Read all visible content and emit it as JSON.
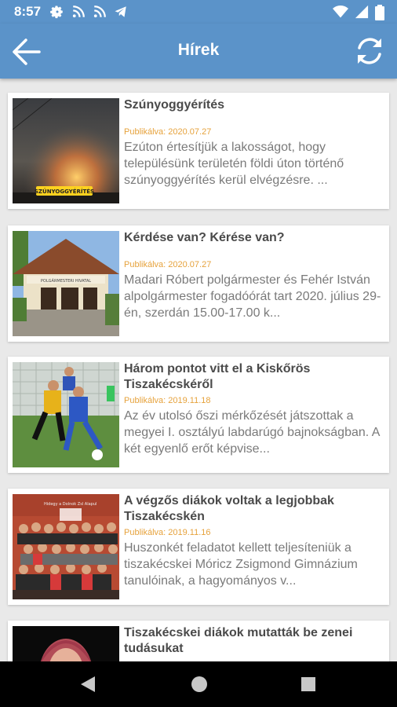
{
  "status_bar": {
    "time": "8:57"
  },
  "app_bar": {
    "title": "Hírek"
  },
  "articles": [
    {
      "title": "Szúnyoggyérítés",
      "date": "Publikálva: 2020.07.27",
      "excerpt": "Ezúton értesítjük a lakosságot, hogy településünk területén földi úton történő szúnyoggyérítés kerül elvégzésre. ...",
      "image_sign_text": "SZÚNYOGGYÉRÍTÉS"
    },
    {
      "title": "Kérdése van? Kérése van?",
      "date": "Publikálva: 2020.07.27",
      "excerpt": "Madari Róbert polgármester és Fehér István alpolgármester fogadóórát tart 2020. július 29-én, szerdán 15.00-17.00 k...",
      "image_sign_text": "POLGÁRMESTERI HIVATAL"
    },
    {
      "title": "Három pontot vitt el a Kiskőrös Tiszakécskéről",
      "date": "Publikálva: 2019.11.18",
      "excerpt": "Az év utolsó őszi mérkőzését játszottak a megyei I. osztályú labdarúgó bajnokságban. A két egyenlő erőt képvise..."
    },
    {
      "title": "A végzős diákok voltak a legjobbak Tiszakécskén",
      "date": "Publikálva: 2019.11.16",
      "excerpt": "Huszonkét feladatot kellett teljesíteniük a tiszakécskei Móricz Zsigmond Gimnázium tanulóinak, a hagyományos v...",
      "image_sign_text": "Hidegy a Dolnok Zsl Alapul"
    },
    {
      "title": "Tiszakécskei diákok mutatták be zenei tudásukat",
      "date": "",
      "excerpt": ""
    }
  ]
}
